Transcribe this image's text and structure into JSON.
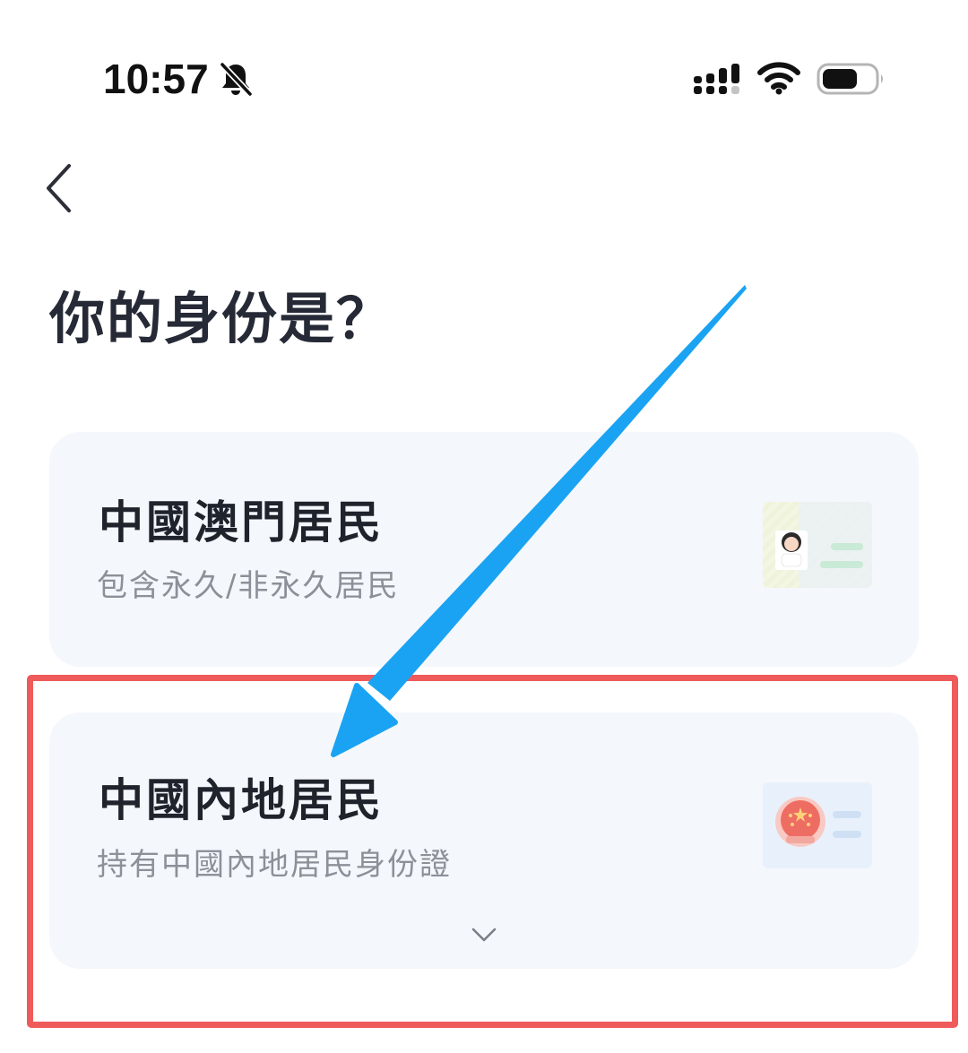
{
  "status_bar": {
    "time": "10:57",
    "icons": [
      "bell-muted-icon",
      "signal-icon",
      "wifi-icon",
      "battery-icon"
    ]
  },
  "nav": {
    "back_icon": "chevron-left-icon"
  },
  "page": {
    "title": "你的身份是？"
  },
  "options": [
    {
      "title": "中國澳門居民",
      "subtitle": "包含永久/非永久居民",
      "icon": "id-card-icon"
    },
    {
      "title": "中國內地居民",
      "subtitle": "持有中國內地居民身份證",
      "icon": "national-emblem-card-icon",
      "expand_icon": "chevron-down-icon"
    }
  ],
  "colors": {
    "card_background": "#f4f7fc",
    "title_text": "#262a36",
    "subtitle_text": "#8b9099",
    "annotation_arrow": "#1aa3f2",
    "annotation_box": "#ef5a5a"
  }
}
